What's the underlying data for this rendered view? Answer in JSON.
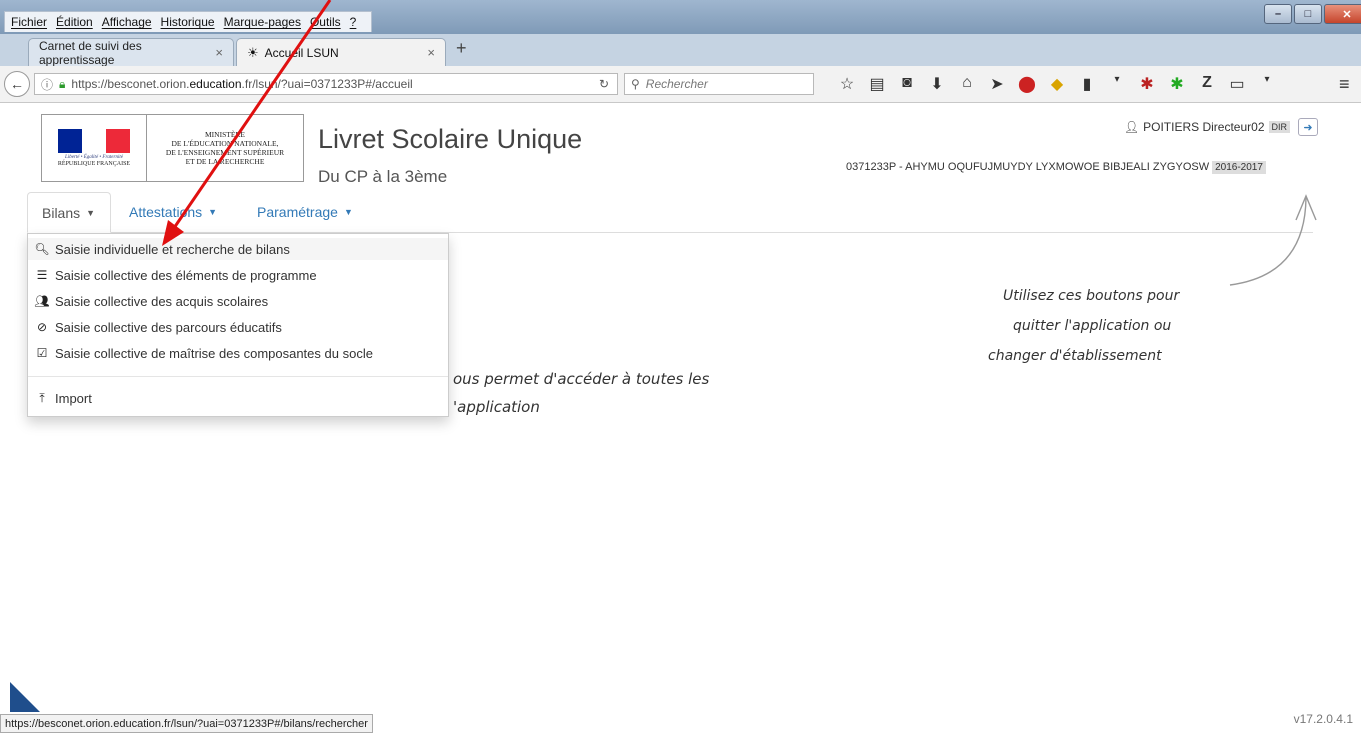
{
  "browser": {
    "menu": [
      "Fichier",
      "Édition",
      "Affichage",
      "Historique",
      "Marque-pages",
      "Outils",
      "?"
    ],
    "tabs": [
      {
        "label": "Carnet de suivi des apprentissage"
      },
      {
        "label": "Accueil LSUN"
      }
    ],
    "tab_close": "×",
    "new_tab": "+",
    "url_prefix": "https://besconet.orion.",
    "url_domain": "education",
    "url_suffix": ".fr/lsun/?uai=0371233P#/accueil",
    "search_placeholder": "Rechercher",
    "status_url": "https://besconet.orion.education.fr/lsun/?uai=0371233P#/bilans/rechercher"
  },
  "header": {
    "ministry": [
      "MINISTÈRE",
      "DE L'ÉDUCATION NATIONALE,",
      "DE L'ENSEIGNEMENT SUPÉRIEUR",
      "ET DE LA RECHERCHE"
    ],
    "motto": "Liberté • Égalité • Fraternité",
    "republic": "RÉPUBLIQUE FRANÇAISE",
    "title": "Livret Scolaire Unique",
    "subtitle": "Du CP à la 3ème",
    "user": "POITIERS Directeur02",
    "role": "DIR",
    "etablissement": "0371233P - AHYMU OQUFUJMUYDY LYXMOWOE BIBJEALI ZYGYOSW",
    "year": "2016-2017",
    "colors": {
      "blue": "#002395",
      "red": "#ED2939"
    }
  },
  "nav": {
    "tabs": [
      {
        "label": "Bilans"
      },
      {
        "label": "Attestations"
      },
      {
        "label": "Paramétrage"
      }
    ]
  },
  "dropdown": {
    "items": [
      {
        "label": "Saisie individuelle et recherche de bilans",
        "icon": "search-icon"
      },
      {
        "label": "Saisie collective des éléments de programme",
        "icon": "list-icon"
      },
      {
        "label": "Saisie collective des acquis scolaires",
        "icon": "users-icon"
      },
      {
        "label": "Saisie collective des parcours éducatifs",
        "icon": "compass-icon"
      },
      {
        "label": "Saisie collective de maîtrise des composantes du socle",
        "icon": "checkbox-icon"
      }
    ],
    "import": {
      "label": "Import",
      "icon": "upload-icon"
    }
  },
  "help": {
    "main_line1": "ous permet d'accéder à toutes les",
    "main_line2": "'application",
    "side_line1": "Utilisez ces boutons pour",
    "side_line2": "quitter l'application ou",
    "side_line3": "changer d'établissement"
  },
  "version": "v17.2.0.4.1"
}
